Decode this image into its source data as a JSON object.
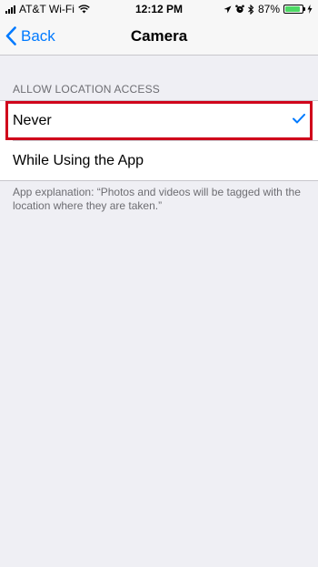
{
  "status_bar": {
    "carrier": "AT&T Wi-Fi",
    "time": "12:12 PM",
    "battery_percent": "87%",
    "battery_level": 0.87
  },
  "nav": {
    "back_label": "Back",
    "title": "Camera"
  },
  "location": {
    "section_header": "ALLOW LOCATION ACCESS",
    "options": [
      {
        "label": "Never",
        "selected": true
      },
      {
        "label": "While Using the App",
        "selected": false
      }
    ],
    "footer": "App explanation: “Photos and videos will be tagged with the location where they are taken.”"
  },
  "colors": {
    "accent": "#007aff",
    "highlight": "#d0021b",
    "battery": "#4cd964"
  }
}
